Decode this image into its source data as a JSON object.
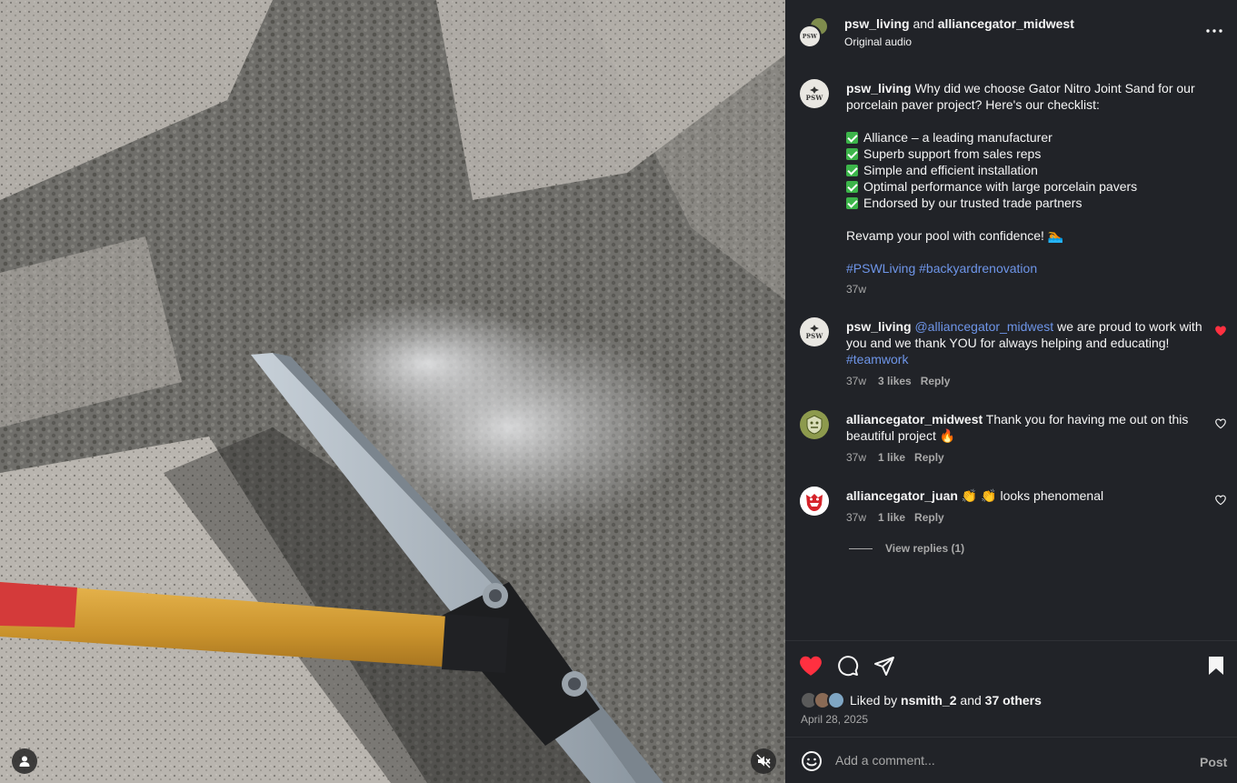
{
  "header": {
    "user1": "psw_living",
    "joiner": " and ",
    "user2": "alliancegator_midwest",
    "subtitle": "Original audio"
  },
  "caption": {
    "username": "psw_living",
    "text_intro": " Why did we choose Gator Nitro Joint Sand for our porcelain paver project? Here's our checklist:",
    "checklist": [
      "Alliance – a leading manufacturer",
      "Superb support from sales reps",
      "Simple and efficient installation",
      "Optimal performance with large porcelain pavers",
      "Endorsed by our trusted trade partners"
    ],
    "closing": "Revamp your pool with confidence! 🏊",
    "hashtags": "#PSWLiving #backyardrenovation",
    "time": "37w"
  },
  "comments": [
    {
      "username": "psw_living",
      "mention": "@alliancegator_midwest",
      "text": " we are proud to work with you and we thank YOU for always helping and educating!",
      "hashtag": "#teamwork",
      "time": "37w",
      "likes": "3 likes",
      "reply": "Reply",
      "liked": true
    },
    {
      "username": "alliancegator_midwest",
      "text": " Thank you for having me out on this beautiful project 🔥",
      "time": "37w",
      "likes": "1 like",
      "reply": "Reply",
      "liked": false
    },
    {
      "username": "alliancegator_juan",
      "text": " 👏 👏 looks phenomenal",
      "time": "37w",
      "likes": "1 like",
      "reply": "Reply",
      "liked": false,
      "view_replies": "View replies (1)"
    }
  ],
  "avatars": {
    "psw_mark": "PSW"
  },
  "actions": {
    "liked_prefix": "Liked by ",
    "liked_user": "nsmith_2",
    "liked_mid": " and ",
    "liked_others": "37 others",
    "date": "April 28, 2025"
  },
  "add_comment": {
    "placeholder": "Add a comment...",
    "post_label": "Post"
  },
  "colors": {
    "panel_bg": "#212328",
    "link": "#6e95e8",
    "like_red": "#ff3040",
    "check_green": "#3cb54a"
  },
  "icons": [
    "more-icon",
    "heart-icon",
    "comment-icon",
    "share-icon",
    "bookmark-icon",
    "emoji-icon",
    "user-tag-icon",
    "muted-speaker-icon"
  ]
}
